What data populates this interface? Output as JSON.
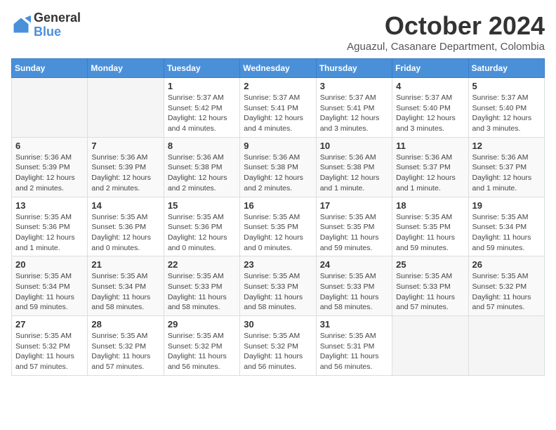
{
  "header": {
    "logo_general": "General",
    "logo_blue": "Blue",
    "month": "October 2024",
    "location": "Aguazul, Casanare Department, Colombia"
  },
  "days_of_week": [
    "Sunday",
    "Monday",
    "Tuesday",
    "Wednesday",
    "Thursday",
    "Friday",
    "Saturday"
  ],
  "weeks": [
    [
      {
        "day": "",
        "info": ""
      },
      {
        "day": "",
        "info": ""
      },
      {
        "day": "1",
        "info": "Sunrise: 5:37 AM\nSunset: 5:42 PM\nDaylight: 12 hours and 4 minutes."
      },
      {
        "day": "2",
        "info": "Sunrise: 5:37 AM\nSunset: 5:41 PM\nDaylight: 12 hours and 4 minutes."
      },
      {
        "day": "3",
        "info": "Sunrise: 5:37 AM\nSunset: 5:41 PM\nDaylight: 12 hours and 3 minutes."
      },
      {
        "day": "4",
        "info": "Sunrise: 5:37 AM\nSunset: 5:40 PM\nDaylight: 12 hours and 3 minutes."
      },
      {
        "day": "5",
        "info": "Sunrise: 5:37 AM\nSunset: 5:40 PM\nDaylight: 12 hours and 3 minutes."
      }
    ],
    [
      {
        "day": "6",
        "info": "Sunrise: 5:36 AM\nSunset: 5:39 PM\nDaylight: 12 hours and 2 minutes."
      },
      {
        "day": "7",
        "info": "Sunrise: 5:36 AM\nSunset: 5:39 PM\nDaylight: 12 hours and 2 minutes."
      },
      {
        "day": "8",
        "info": "Sunrise: 5:36 AM\nSunset: 5:38 PM\nDaylight: 12 hours and 2 minutes."
      },
      {
        "day": "9",
        "info": "Sunrise: 5:36 AM\nSunset: 5:38 PM\nDaylight: 12 hours and 2 minutes."
      },
      {
        "day": "10",
        "info": "Sunrise: 5:36 AM\nSunset: 5:38 PM\nDaylight: 12 hours and 1 minute."
      },
      {
        "day": "11",
        "info": "Sunrise: 5:36 AM\nSunset: 5:37 PM\nDaylight: 12 hours and 1 minute."
      },
      {
        "day": "12",
        "info": "Sunrise: 5:36 AM\nSunset: 5:37 PM\nDaylight: 12 hours and 1 minute."
      }
    ],
    [
      {
        "day": "13",
        "info": "Sunrise: 5:35 AM\nSunset: 5:36 PM\nDaylight: 12 hours and 1 minute."
      },
      {
        "day": "14",
        "info": "Sunrise: 5:35 AM\nSunset: 5:36 PM\nDaylight: 12 hours and 0 minutes."
      },
      {
        "day": "15",
        "info": "Sunrise: 5:35 AM\nSunset: 5:36 PM\nDaylight: 12 hours and 0 minutes."
      },
      {
        "day": "16",
        "info": "Sunrise: 5:35 AM\nSunset: 5:35 PM\nDaylight: 12 hours and 0 minutes."
      },
      {
        "day": "17",
        "info": "Sunrise: 5:35 AM\nSunset: 5:35 PM\nDaylight: 11 hours and 59 minutes."
      },
      {
        "day": "18",
        "info": "Sunrise: 5:35 AM\nSunset: 5:35 PM\nDaylight: 11 hours and 59 minutes."
      },
      {
        "day": "19",
        "info": "Sunrise: 5:35 AM\nSunset: 5:34 PM\nDaylight: 11 hours and 59 minutes."
      }
    ],
    [
      {
        "day": "20",
        "info": "Sunrise: 5:35 AM\nSunset: 5:34 PM\nDaylight: 11 hours and 59 minutes."
      },
      {
        "day": "21",
        "info": "Sunrise: 5:35 AM\nSunset: 5:34 PM\nDaylight: 11 hours and 58 minutes."
      },
      {
        "day": "22",
        "info": "Sunrise: 5:35 AM\nSunset: 5:33 PM\nDaylight: 11 hours and 58 minutes."
      },
      {
        "day": "23",
        "info": "Sunrise: 5:35 AM\nSunset: 5:33 PM\nDaylight: 11 hours and 58 minutes."
      },
      {
        "day": "24",
        "info": "Sunrise: 5:35 AM\nSunset: 5:33 PM\nDaylight: 11 hours and 58 minutes."
      },
      {
        "day": "25",
        "info": "Sunrise: 5:35 AM\nSunset: 5:33 PM\nDaylight: 11 hours and 57 minutes."
      },
      {
        "day": "26",
        "info": "Sunrise: 5:35 AM\nSunset: 5:32 PM\nDaylight: 11 hours and 57 minutes."
      }
    ],
    [
      {
        "day": "27",
        "info": "Sunrise: 5:35 AM\nSunset: 5:32 PM\nDaylight: 11 hours and 57 minutes."
      },
      {
        "day": "28",
        "info": "Sunrise: 5:35 AM\nSunset: 5:32 PM\nDaylight: 11 hours and 57 minutes."
      },
      {
        "day": "29",
        "info": "Sunrise: 5:35 AM\nSunset: 5:32 PM\nDaylight: 11 hours and 56 minutes."
      },
      {
        "day": "30",
        "info": "Sunrise: 5:35 AM\nSunset: 5:32 PM\nDaylight: 11 hours and 56 minutes."
      },
      {
        "day": "31",
        "info": "Sunrise: 5:35 AM\nSunset: 5:31 PM\nDaylight: 11 hours and 56 minutes."
      },
      {
        "day": "",
        "info": ""
      },
      {
        "day": "",
        "info": ""
      }
    ]
  ]
}
